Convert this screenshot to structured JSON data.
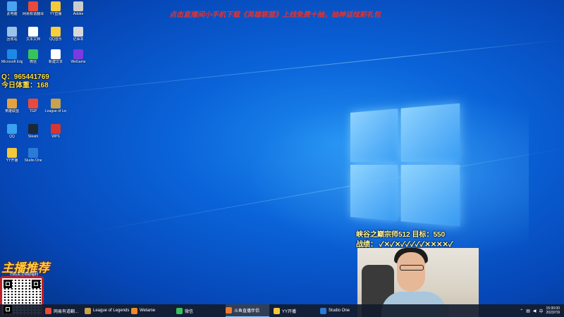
{
  "banner": "点击直播间小手机下载《英雄联盟》上线免费十抽，抽神话炫彩礼包",
  "qq": "Q：965441769",
  "tili": "今日体重：168",
  "rank": "峡谷之巅宗师512 目标：550",
  "record": "战绩：  ✓✕✓✕✓✓✓✓✓✕✕✕✕✓",
  "promo": "主播推荐",
  "promo_sub": "扫码关注领取福利",
  "icons": [
    {
      "label": "此电脑",
      "color": "#4aa3f0"
    },
    {
      "label": "网易有道翻译",
      "color": "#e84a3c"
    },
    {
      "label": "YY直播",
      "color": "#f3c93a"
    },
    {
      "label": "Adobe",
      "color": "#cccccc"
    },
    {
      "label": "回收站",
      "color": "#9bc2e8"
    },
    {
      "label": "文本文档",
      "color": "#ffffff"
    },
    {
      "label": "QQ音乐",
      "color": "#f8cf3a"
    },
    {
      "label": "记事本",
      "color": "#d8d8d8"
    },
    {
      "label": "Microsoft Edge",
      "color": "#1e88e5"
    },
    {
      "label": "微信",
      "color": "#39c25b"
    },
    {
      "label": "新建文本",
      "color": "#ffffff"
    },
    {
      "label": "WeGame",
      "color": "#7c3be0"
    },
    {
      "label": "英雄联盟",
      "color": "#e6a23c"
    },
    {
      "label": "TGP",
      "color": "#e84a3c"
    },
    {
      "label": "League of Legends",
      "color": "#c9a24a"
    },
    {
      "label": "QQ",
      "color": "#3aa0f0"
    },
    {
      "label": "Steam",
      "color": "#1b2838"
    },
    {
      "label": "WPS",
      "color": "#d6362f"
    },
    {
      "label": "YY开播",
      "color": "#f3c93a"
    },
    {
      "label": "Studio One",
      "color": "#2a7ad8"
    }
  ],
  "taskbar": {
    "items": [
      {
        "label": "网易有道翻...",
        "color": "#e84a3c"
      },
      {
        "label": "League of Legends",
        "color": "#c9a24a"
      },
      {
        "label": "Wetame",
        "color": "#f08a24"
      },
      {
        "label": "微信",
        "color": "#39c25b"
      },
      {
        "label": "斗鱼直播伴侣",
        "color": "#f07b2a"
      },
      {
        "label": "YY开播",
        "color": "#f3c93a"
      },
      {
        "label": "Studio One",
        "color": "#2a7ad8"
      }
    ],
    "time": "15:00:00",
    "date": "2023/7/9"
  }
}
